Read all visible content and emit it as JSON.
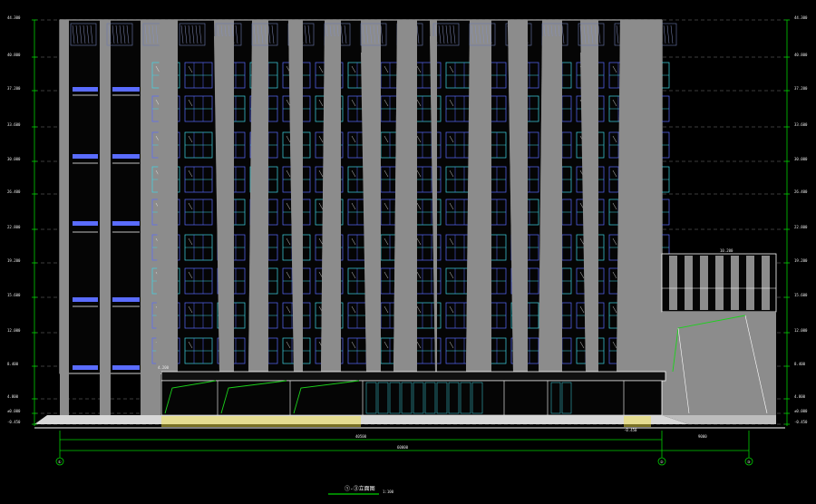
{
  "drawing": {
    "title": "①-③立面图",
    "scale": "1:100",
    "colors": {
      "background": "#000000",
      "facade": "#8c8c8c",
      "glazing_blue": "#5a6cff",
      "glazing_cyan": "#3fd7e6",
      "frame_white": "#ffffff",
      "dimension_green": "#00d000",
      "level_dash": "#7a7a7a",
      "stair_yellow": "#f2e24a",
      "canopy_green": "#1bd21b"
    }
  },
  "axes": {
    "labels": [
      "①",
      "②",
      "③"
    ]
  },
  "dimensions": {
    "overall": "60000",
    "segment_main": "40500",
    "segment_annex": "9000"
  },
  "levels": {
    "left": [
      "44.300",
      "40.800",
      "37.200",
      "33.600",
      "30.000",
      "26.400",
      "22.800",
      "19.200",
      "15.600",
      "12.000",
      "8.400",
      "4.800",
      "±0.000",
      "-0.450"
    ],
    "right": [
      "44.300",
      "40.800",
      "37.200",
      "33.600",
      "30.000",
      "26.400",
      "22.800",
      "19.200",
      "15.600",
      "12.000",
      "8.400",
      "4.800",
      "±0.000",
      "-0.450"
    ]
  },
  "annotations": {
    "canopy_level": "4.200",
    "annex_roof": "10.200",
    "ground_label": "-0.450"
  }
}
